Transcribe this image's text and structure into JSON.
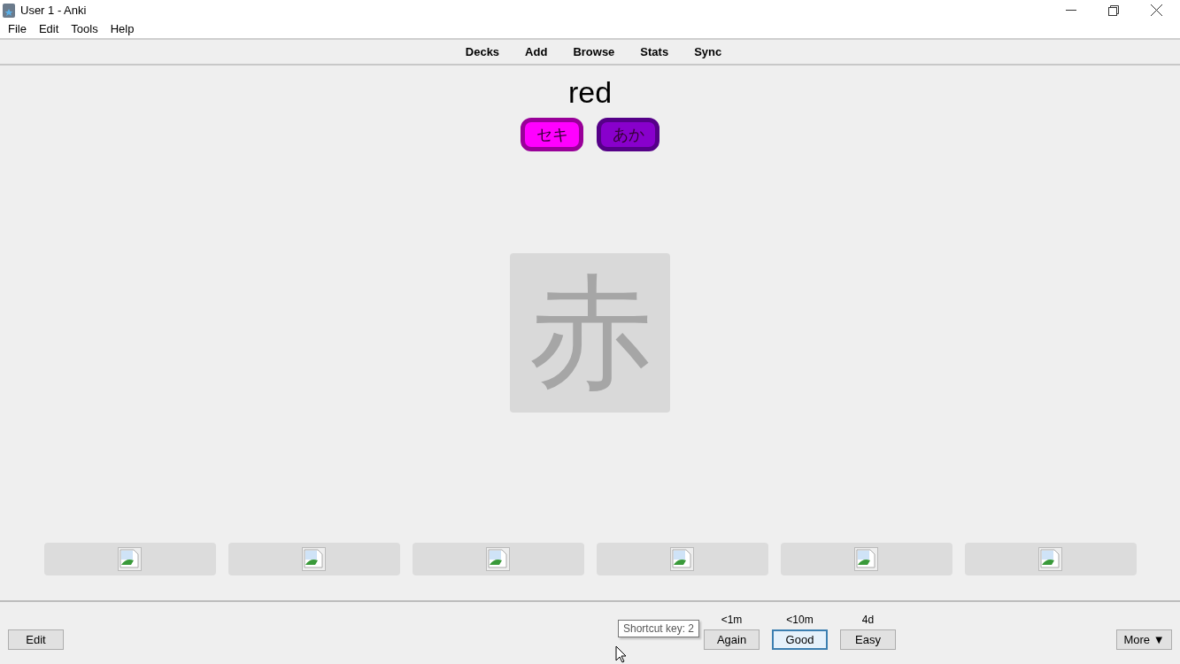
{
  "window": {
    "title": "User 1 - Anki"
  },
  "menu": [
    "File",
    "Edit",
    "Tools",
    "Help"
  ],
  "toolbar": [
    "Decks",
    "Add",
    "Browse",
    "Stats",
    "Sync"
  ],
  "card": {
    "word": "red",
    "readings": [
      {
        "text": "セキ",
        "color": "#ff00ff"
      },
      {
        "text": "あか",
        "color": "#8800cc"
      }
    ],
    "kanji": "赤"
  },
  "bottom": {
    "edit": "Edit",
    "more": "More ▼",
    "answers": [
      {
        "interval": "<1m",
        "label": "Again",
        "focused": false
      },
      {
        "interval": "<10m",
        "label": "Good",
        "focused": true
      },
      {
        "interval": "4d",
        "label": "Easy",
        "focused": false
      }
    ],
    "tooltip": "Shortcut key: 2"
  }
}
